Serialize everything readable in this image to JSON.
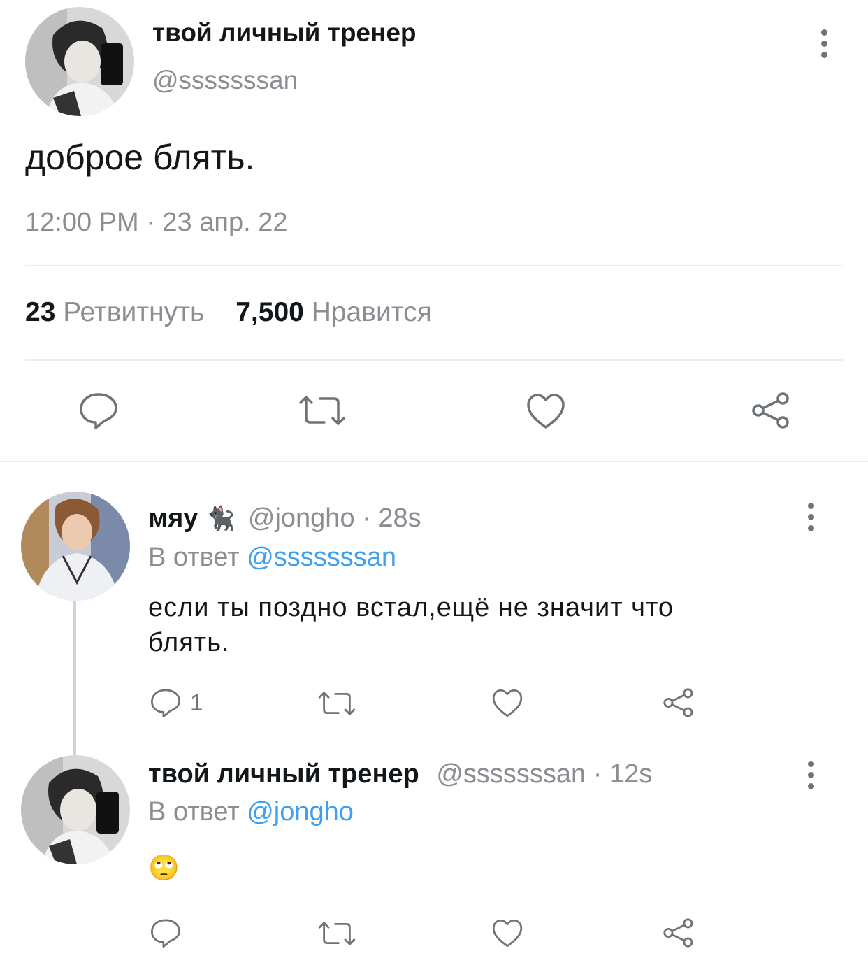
{
  "main_tweet": {
    "display_name": "твой личный тренер",
    "handle": "@sssssssan",
    "text": "доброе блять.",
    "timestamp": "12:00 PM · 23 апр. 22",
    "retweets_count": "23",
    "retweets_label": "Ретвитнуть",
    "likes_count": "7,500",
    "likes_label": "Нравится",
    "actions": [
      "reply-icon",
      "retweet-icon",
      "like-icon",
      "share-icon"
    ]
  },
  "replies": [
    {
      "display_name": "мяу",
      "name_emoji": "🐈‍⬛",
      "handle": "@jongho",
      "time": "· 28s",
      "reply_prefix": "В ответ",
      "reply_to": "@sssssssan",
      "text": "если ты поздно встал,ещё не значит что блять.",
      "reply_count": "1"
    },
    {
      "display_name": "твой личный тренер",
      "handle": "@sssssssan",
      "time": "· 12s",
      "reply_prefix": "В ответ",
      "reply_to": "@jongho",
      "text": "🙄",
      "reply_count": ""
    }
  ],
  "colors": {
    "link": "#3f9ff0",
    "text": "#14171a",
    "secondary": "#8a8d91",
    "divider": "#ebeef0",
    "icon": "#6e7378"
  }
}
